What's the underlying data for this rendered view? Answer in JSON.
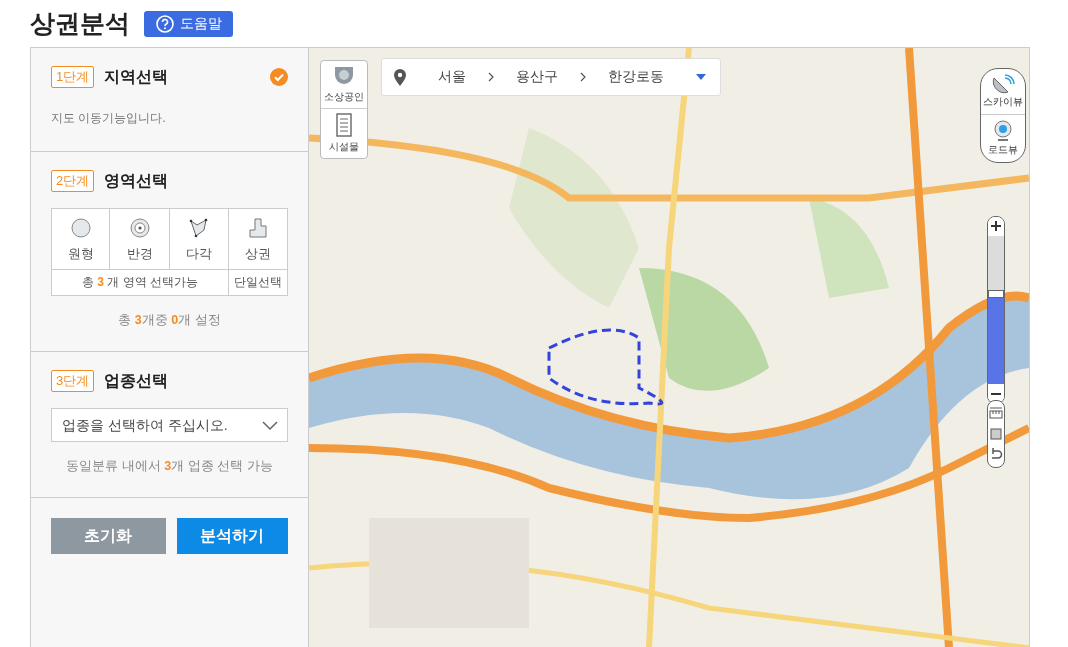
{
  "header": {
    "title": "상권분석",
    "help_button": "도움말"
  },
  "step1": {
    "badge": "1단계",
    "title": "지역선택",
    "done": true,
    "note": "지도 이동기능입니다."
  },
  "step2": {
    "badge": "2단계",
    "title": "영역선택",
    "done": false,
    "tools": [
      {
        "kind": "circle",
        "label": "원형",
        "selected": false
      },
      {
        "kind": "radius",
        "label": "반경",
        "selected": false
      },
      {
        "kind": "polygon",
        "label": "다각",
        "selected": false
      },
      {
        "kind": "district",
        "label": "상권",
        "selected": false
      }
    ],
    "multi_note": "총 **3** 개 영역 선택가능",
    "single_note": "단일선택",
    "summary": "총 **3**개중 **0**개 설정"
  },
  "step3": {
    "badge": "3단계",
    "title": "업종선택",
    "done": false,
    "select": {
      "placeholder": "업종을 선택하여 주십시오."
    },
    "note": "동일분류 내에서 **3**개 업종 선택 가능"
  },
  "actions": {
    "reset": "초기화",
    "analyze": "분석하기"
  },
  "map": {
    "layers": [
      {
        "kind": "business",
        "label": "소상공인"
      },
      {
        "kind": "facility",
        "label": "시설물"
      }
    ],
    "location": [
      "서울",
      "용산구",
      "한강로동"
    ],
    "views": [
      {
        "kind": "sky",
        "label": "스카이뷰"
      },
      {
        "kind": "road",
        "label": "로드뷰"
      }
    ],
    "zoom": {
      "level": 0.58
    }
  }
}
